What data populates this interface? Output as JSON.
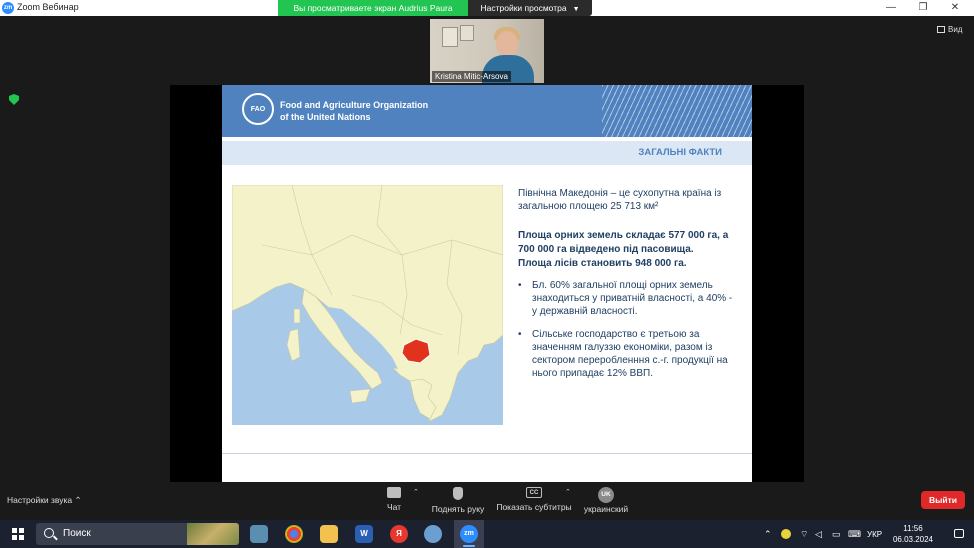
{
  "window": {
    "app_title": "Zoom Вебинар",
    "app_icon_text": "zm",
    "share_banner": "Вы просматриваете экран Audrius Paura",
    "view_options": "Настройки просмотра",
    "view_button": "Вид"
  },
  "participant": {
    "name": "Kristina Mitic-Arsova"
  },
  "slide": {
    "org_name": "Food and Agriculture Organization\nof the United Nations",
    "logo_text": "FAO",
    "section_title": "ЗАГАЛЬНІ ФАКТИ",
    "intro": "Північна Македонія – це сухопутна країна із загальною площею 25 713 км²",
    "bold_lines": [
      "Площа орних земель складає 577 000 га, а 700 000 га відведено під пасовища.",
      "Площа лісів становить 948 000 га."
    ],
    "bullets": [
      " Бл. 60% загальної площі орних земель знаходиться у приватній власності, а 40% - у державній власності.",
      "Сільське господарство є третьою за значенням галуззю економіки, разом із сектором переробленння с.-г. продукції на нього припадає 12% ВВП."
    ],
    "colors": {
      "header_blue": "#4f82bf",
      "text_navy": "#1f3f63",
      "map_sea": "#a9c9e8",
      "map_land": "#f4f2c9",
      "highlight_red": "#e0321c"
    }
  },
  "toolbar": {
    "sound_settings": "Настройки звука",
    "chat": "Чат",
    "raise_hand": "Поднять руку",
    "captions": "Показать субтитры",
    "captions_icon": "CC",
    "language_icon": "UK",
    "language": "украинский",
    "leave": "Выйти"
  },
  "taskbar": {
    "search_placeholder": "Поиск",
    "word_icon": "W",
    "yandex_icon": "Я",
    "zoom_icon": "zm",
    "lang": "УКР",
    "time": "11:56",
    "date": "06.03.2024"
  }
}
